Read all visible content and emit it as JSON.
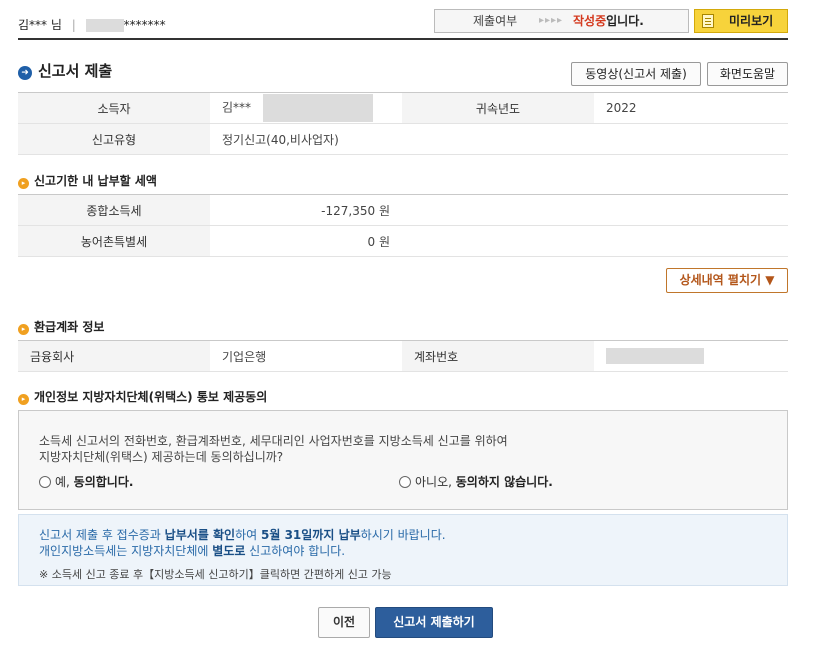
{
  "header": {
    "user_name": "김***",
    "honorific": "님",
    "separator": "|",
    "id_masked": "*******",
    "status_label": "제출여부",
    "status_arrows": "▸▸▸▸",
    "status_value": "작성중",
    "status_suffix": "입니다.",
    "preview_label": "미리보기"
  },
  "section": {
    "title": "신고서 제출",
    "video_btn": "동영상(신고서 제출)",
    "help_btn": "화면도움말"
  },
  "basic": {
    "earner_label": "소득자",
    "earner_value": "김***",
    "year_label": "귀속년도",
    "year_value": "2022",
    "type_label": "신고유형",
    "type_value": "정기신고(40,비사업자)"
  },
  "tax": {
    "title": "신고기한 내 납부할 세액",
    "rows": [
      {
        "label": "종합소득세",
        "value": "-127,350",
        "unit": "원"
      },
      {
        "label": "농어촌특별세",
        "value": "0",
        "unit": "원"
      }
    ],
    "detail_btn": "상세내역 펼치기 ▼"
  },
  "refund": {
    "title": "환급계좌 정보",
    "bank_label": "금융회사",
    "bank_value": "기업은행",
    "account_label": "계좌번호"
  },
  "consent": {
    "title": "개인정보 지방자치단체(위택스) 통보 제공동의",
    "line1": "소득세 신고서의 전화번호, 환급계좌번호, 세무대리인 사업자번호를 지방소득세 신고를 위하여",
    "line2": "지방자치단체(위택스) 제공하는데 동의하십니까?",
    "yes_prefix": "예, ",
    "yes_bold": "동의합니다.",
    "no_prefix": "아니오, ",
    "no_bold": "동의하지 않습니다."
  },
  "info": {
    "l1a": "신고서 제출 후 접수증과 ",
    "l1b": "납부서를 확인",
    "l1c": "하여 ",
    "l1d": "5월 31일까지 납부",
    "l1e": "하시기 바랍니다.",
    "l2a": "개인지방소득세는 지방자치단체에 ",
    "l2b": "별도로",
    "l2c": " 신고하여야 합니다.",
    "note": "※ 소득세 신고 종료 후【지방소득세 신고하기】클릭하면 간편하게 신고 가능"
  },
  "actions": {
    "prev": "이전",
    "submit": "신고서 제출하기"
  },
  "colors": {
    "accent": "#2d5e9c",
    "status": "#d4391e",
    "preview": "#f7d33b"
  }
}
